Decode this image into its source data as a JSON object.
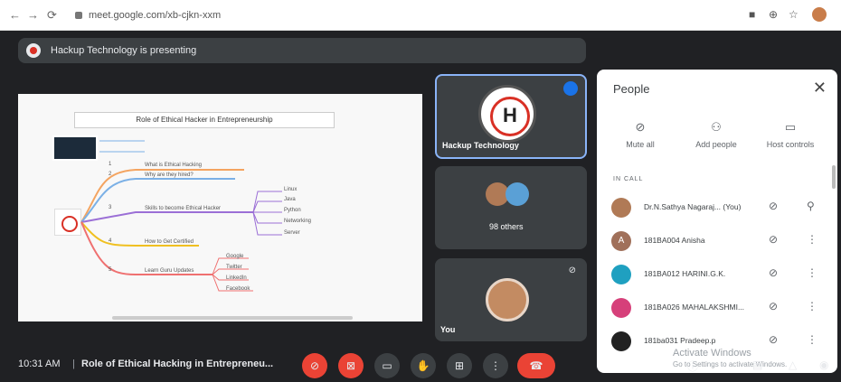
{
  "browser": {
    "url": "meet.google.com/xb-cjkn-xxm",
    "back": "←",
    "forward": "→",
    "reload": "⟳"
  },
  "meeting": {
    "presenting_banner": "Hackup Technology is presenting",
    "slide_title": "Role of Ethical Hacker in Entrepreneurship",
    "mindmap": {
      "branches": [
        "What is Ethical Hacking",
        "Why are they hired?",
        "Skills to become Ethical Hacker",
        "How to Get Certified",
        "Learn Guru Updates"
      ],
      "numbers": [
        "1",
        "2",
        "3",
        "4",
        "5"
      ],
      "skills": [
        "Linux",
        "Java",
        "Python",
        "Networking",
        "Server"
      ],
      "social": [
        "Google",
        "Twitter",
        "LinkedIn",
        "Facebook"
      ]
    },
    "tiles": {
      "presenter_name": "Hackup Technology",
      "others_label": "98 others",
      "you_label": "You"
    },
    "clock": "10:31 AM",
    "separator": "|",
    "meeting_title": "Role of Ethical Hacking in Entrepreneu..."
  },
  "people_panel": {
    "title": "People",
    "close": "✕",
    "actions": [
      {
        "label": "Mute all",
        "glyph": "⊘"
      },
      {
        "label": "Add people",
        "glyph": "⚇"
      },
      {
        "label": "Host controls",
        "glyph": "▭"
      }
    ],
    "in_call_label": "IN CALL",
    "participants": [
      {
        "name": "Dr.N.Sathya Nagaraj... (You)",
        "initial": "",
        "color": "#b07a56",
        "right": "⚲"
      },
      {
        "name": "181BA004 Anisha",
        "initial": "A",
        "color": "#a0705a",
        "right": "⋮"
      },
      {
        "name": "181BA012 HARINI.G.K.",
        "initial": "",
        "color": "#1fa0c0",
        "right": "⋮"
      },
      {
        "name": "181BA026 MAHALAKSHMI...",
        "initial": "",
        "color": "#d6407a",
        "right": "⋮"
      },
      {
        "name": "181ba031 Pradeep.p",
        "initial": "",
        "color": "#222222",
        "right": "⋮"
      }
    ],
    "mic_off_glyph": "⊘"
  },
  "watermark": {
    "line1": "Activate Windows",
    "line2": "Go to Settings to activate Windows."
  },
  "colors": {
    "meet_bg": "#202124",
    "tile_bg": "#3c4043",
    "red": "#ea4335",
    "accent": "#8ab4f8"
  }
}
